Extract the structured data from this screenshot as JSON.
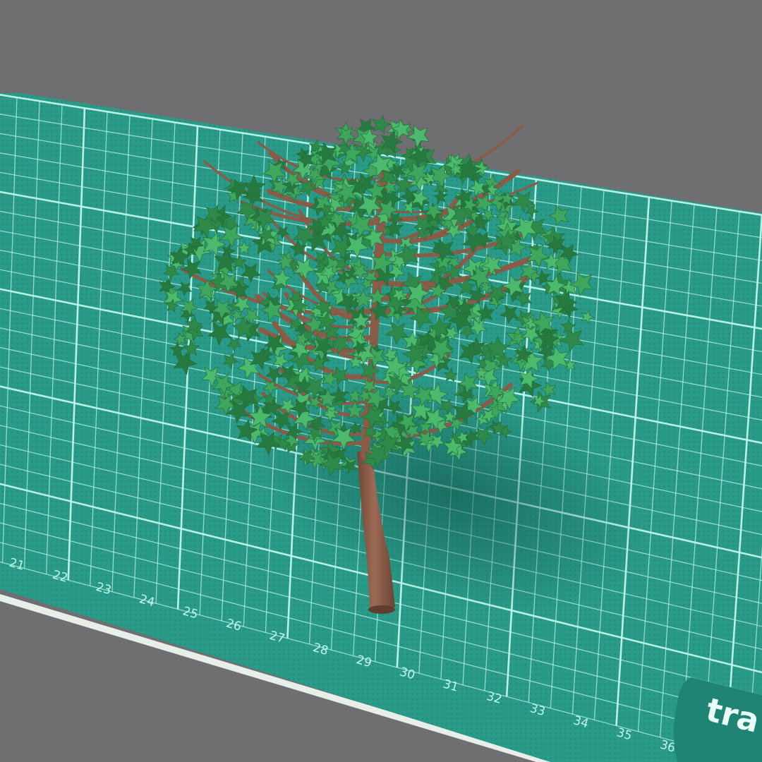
{
  "scene": {
    "background_color": "#6f6f72",
    "mat_color": "#2a9a89",
    "grid_line_color": "#bff7ea",
    "ruler_numbers": [
      "21",
      "22",
      "23",
      "24",
      "25",
      "26",
      "27",
      "28",
      "29",
      "30",
      "31",
      "32",
      "33",
      "34",
      "35",
      "36"
    ],
    "brand_label": "tra",
    "tree": {
      "trunk_color": "#8a5c48",
      "leaf_colors": [
        "#2f8a4a",
        "#3fa65d",
        "#4cba6c",
        "#267a3f"
      ]
    }
  }
}
